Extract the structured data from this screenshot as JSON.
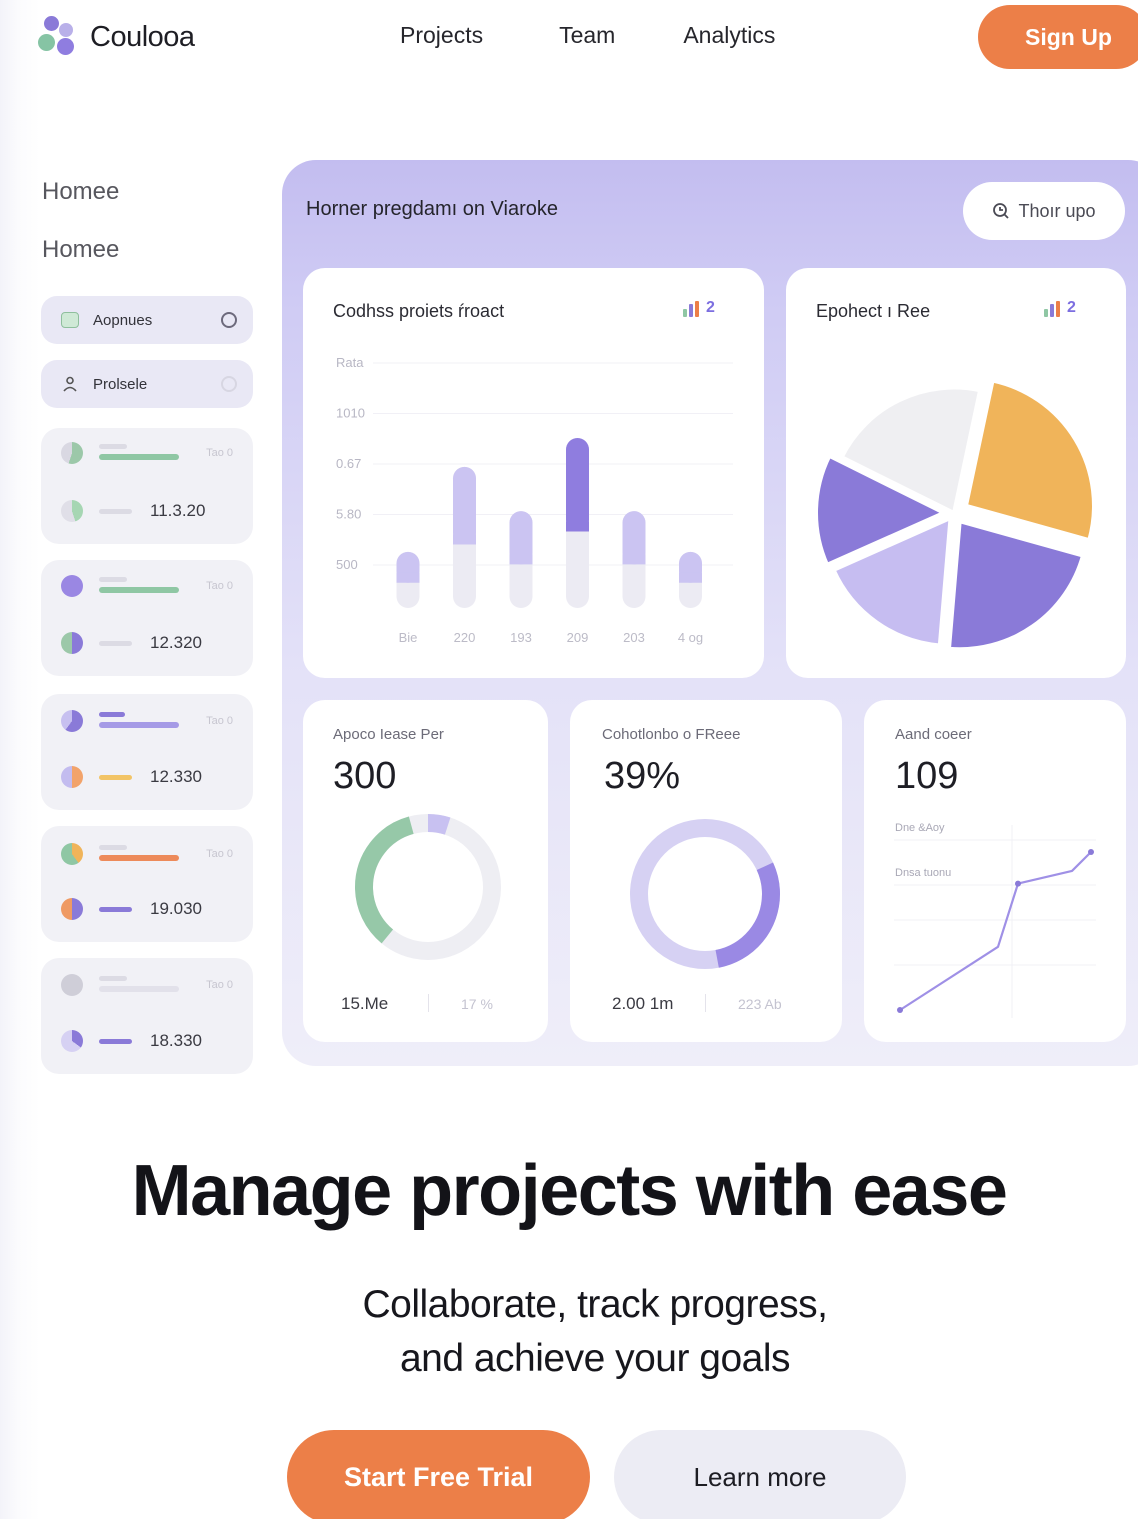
{
  "header": {
    "brand": "Coulooa",
    "nav": [
      "Projects",
      "Team",
      "Analytics"
    ],
    "signup_label": "Sign Up"
  },
  "sidebar": {
    "headings": [
      "Homee",
      "Homee"
    ],
    "pills": [
      {
        "label": "Aopnues",
        "icon": "image-icon"
      },
      {
        "label": "Prolsele",
        "icon": "user-icon"
      }
    ],
    "cards": [
      {
        "tag": "Tao 0",
        "value": "11.3.20",
        "bar_color": "#8fc7a4"
      },
      {
        "tag": "Tao 0",
        "value": "12.320",
        "bar_color": "#8fc7a4"
      },
      {
        "tag": "Tao 0",
        "value": "12.330",
        "bar_color": "#a59ae6"
      },
      {
        "tag": "Tao 0",
        "value": "19.030",
        "bar_color": "#ed8a5a"
      },
      {
        "tag": "Tao 0",
        "value": "18.330",
        "bar_color": "#dcdbe4"
      }
    ]
  },
  "dashboard": {
    "title": "Horner pregdamı on Viaroke",
    "action_label": "Thoır upo",
    "bar_card": {
      "title": "Codhss proiets ŕroact",
      "badge": "2"
    },
    "pie_card": {
      "title": "Epohect ı Ree",
      "badge": "2"
    },
    "stat_cards": [
      {
        "label": "Apoco Iease Per",
        "value": "300",
        "foot_value": "15.Me",
        "foot_muted": "17 %"
      },
      {
        "label": "Cohotlonbo o FReee",
        "value": "39%",
        "foot_value": "2.00 1m",
        "foot_muted": "223 Ab"
      },
      {
        "label": "Aand coeer",
        "value": "109",
        "note_1": "Dne &Aoy",
        "note_2": "Dnsa tuonu"
      }
    ]
  },
  "hero": {
    "title": "Manage projects with ease",
    "subtitle_line1": "Collaborate, track progress,",
    "subtitle_line2": "and achieve your goals",
    "cta_primary": "Start Free Trial",
    "cta_secondary": "Learn more"
  },
  "colors": {
    "accent": "#ec7f48",
    "purple": "#8a7ad8",
    "lavender": "#c3bdf0",
    "green": "#8fc7a4",
    "yellow": "#f0b45a"
  },
  "chart_data": [
    {
      "type": "bar",
      "title": "Codhss proiets ŕroact",
      "categories": [
        "Bie",
        "220",
        "193",
        "209",
        "203",
        "4 og"
      ],
      "y_tick_labels": [
        "Rata",
        "1010",
        "0.67",
        "5.80",
        "500"
      ],
      "values": [
        0.33,
        0.83,
        0.57,
        1.0,
        0.57,
        0.33
      ],
      "highlight_index": 3
    },
    {
      "type": "pie",
      "title": "Epohect ı Ree",
      "slices": [
        {
          "value": 0.26,
          "color": "#f0b45a"
        },
        {
          "value": 0.22,
          "color": "#8a7ad8"
        },
        {
          "value": 0.17,
          "color": "#c6bdf1"
        },
        {
          "value": 0.14,
          "color": "#8a7ad8"
        },
        {
          "value": 0.21,
          "color": "#efeff2"
        }
      ]
    },
    {
      "type": "line",
      "title": "Aand coeer",
      "x": [
        0,
        1,
        2,
        3,
        4
      ],
      "values": [
        0.0,
        0.4,
        0.8,
        0.88,
        1.0
      ]
    }
  ]
}
